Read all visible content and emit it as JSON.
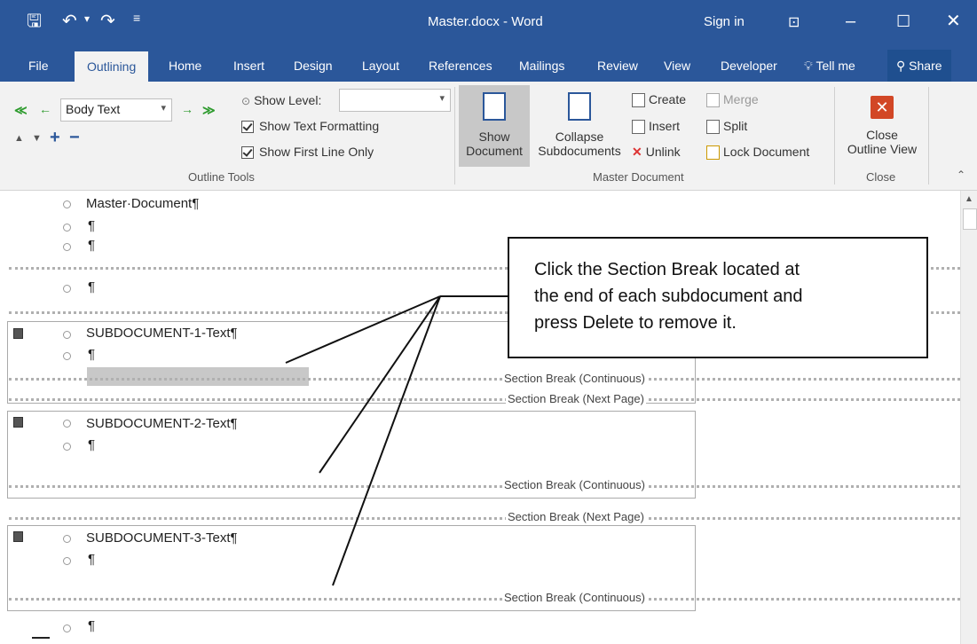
{
  "titlebar": {
    "title": "Master.docx - Word",
    "sign_in": "Sign in",
    "save_icon": "save-icon",
    "undo_icon": "undo-icon",
    "redo_icon": "redo-icon"
  },
  "tabs": [
    "File",
    "Outlining",
    "Home",
    "Insert",
    "Design",
    "Layout",
    "References",
    "Mailings",
    "Review",
    "View",
    "Developer"
  ],
  "tell_me": "Tell me",
  "share": "Share",
  "ribbon": {
    "outline_tools": {
      "level_value": "Body Text",
      "show_level_label": "Show Level:",
      "show_level_value": "",
      "show_text_formatting": "Show Text Formatting",
      "show_first_line_only": "Show First Line Only",
      "group_label": "Outline Tools"
    },
    "master_document": {
      "show_document_1": "Show",
      "show_document_2": "Document",
      "collapse_1": "Collapse",
      "collapse_2": "Subdocuments",
      "create": "Create",
      "insert": "Insert",
      "unlink": "Unlink",
      "merge": "Merge",
      "split": "Split",
      "lock_document": "Lock Document",
      "group_label": "Master Document"
    },
    "close": {
      "close_1": "Close",
      "close_2": "Outline View",
      "group_label": "Close"
    }
  },
  "document": {
    "title_line": "Master·Document¶",
    "para": "¶",
    "sub1": "SUBDOCUMENT-1-Text¶",
    "sub2": "SUBDOCUMENT-2-Text¶",
    "sub3": "SUBDOCUMENT-3-Text¶",
    "break_continuous": "Section Break (Continuous)",
    "break_next_page": "Section Break (Next Page)"
  },
  "callout": {
    "line1": "Click the Section Break  located at",
    "line2": "the end of each subdocument and",
    "line3": "press Delete to remove it."
  }
}
